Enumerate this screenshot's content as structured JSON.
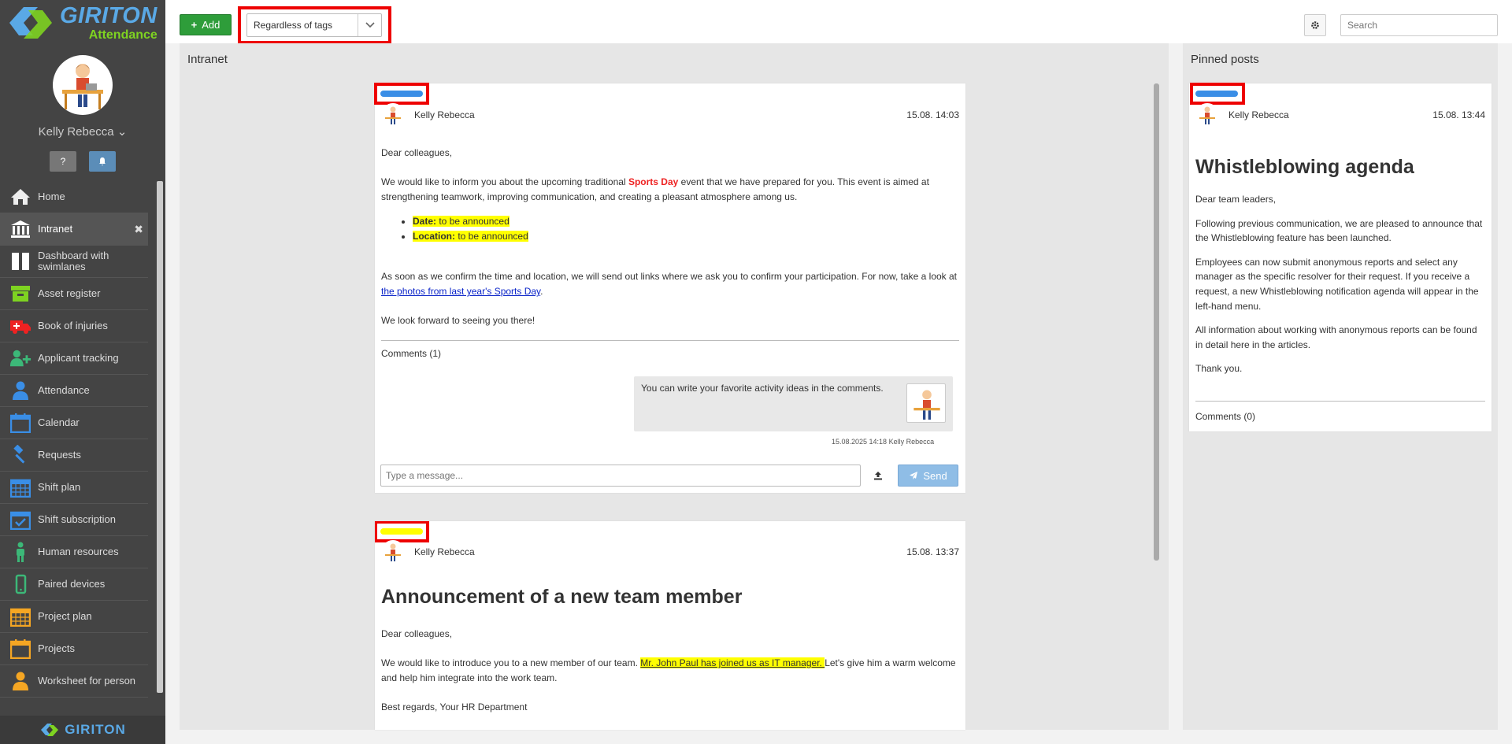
{
  "brand": {
    "name": "GIRITON",
    "product": "Attendance",
    "footer": "GIRITON"
  },
  "user": {
    "name": "Kelly Rebecca"
  },
  "sidebar": {
    "items": [
      {
        "label": "Home",
        "icon": "home-icon",
        "active": false
      },
      {
        "label": "Intranet",
        "icon": "bank-icon",
        "active": true
      },
      {
        "label": "Dashboard with swimlanes",
        "icon": "columns-icon",
        "active": false
      },
      {
        "label": "Asset register",
        "icon": "archive-icon",
        "active": false
      },
      {
        "label": "Book of injuries",
        "icon": "ambulance-icon",
        "active": false
      },
      {
        "label": "Applicant tracking",
        "icon": "user-plus-icon",
        "active": false
      },
      {
        "label": "Attendance",
        "icon": "user-icon",
        "active": false
      },
      {
        "label": "Calendar",
        "icon": "calendar-icon",
        "active": false
      },
      {
        "label": "Requests",
        "icon": "gavel-icon",
        "active": false
      },
      {
        "label": "Shift plan",
        "icon": "calendar-grid-icon",
        "active": false
      },
      {
        "label": "Shift subscription",
        "icon": "calendar-check-icon",
        "active": false
      },
      {
        "label": "Human resources",
        "icon": "person-icon",
        "active": false
      },
      {
        "label": "Paired devices",
        "icon": "mobile-icon",
        "active": false
      },
      {
        "label": "Project plan",
        "icon": "calendar-grid-icon",
        "active": false
      },
      {
        "label": "Projects",
        "icon": "calendar-icon",
        "active": false
      },
      {
        "label": "Worksheet for person",
        "icon": "user-icon",
        "active": false
      }
    ]
  },
  "toolbar": {
    "add_label": "Add",
    "tag_filter": "Regardless of tags",
    "search_placeholder": "Search"
  },
  "intranet": {
    "title": "Intranet",
    "posts": [
      {
        "tag_color": "#3a8ee6",
        "author": "Kelly Rebecca",
        "time": "15.08. 14:03",
        "greeting": "Dear colleagues,",
        "p1_a": "We would like to inform you about the upcoming traditional ",
        "p1_highlight": "Sports Day",
        "p1_b": " event that we have prepared for you. This event is aimed at strengthening teamwork, improving communication, and creating a pleasant atmosphere among us.",
        "date_label": "Date:",
        "date_value": " to be announced",
        "location_label": "Location:",
        "location_value": " to be announced",
        "p2": "As soon as we confirm the time and location, we will send out links where we ask you to confirm your participation. For now, take a look at ",
        "p2_link": "the photos from last year's Sports Day",
        "p2_end": ".",
        "closing": "We look forward to seeing you there!",
        "comments_label": "Comments (1)",
        "comment_text": "You can write your favorite activity ideas in the comments.",
        "comment_meta": "15.08.2025 14:18 Kelly Rebecca",
        "message_placeholder": "Type a message...",
        "send_label": "Send"
      },
      {
        "tag_color": "#ffff00",
        "author": "Kelly Rebecca",
        "time": "15.08. 13:37",
        "title": "Announcement of a new team member",
        "greeting": "Dear colleagues,",
        "p1_a": "We would like to introduce you to a new member of our team. ",
        "p1_highlight": "Mr. John Paul has joined us as IT manager. ",
        "p1_b": "Let's give him a warm welcome and help him integrate into the work team.",
        "closing": "Best regards, Your HR Department"
      }
    ]
  },
  "pinned": {
    "title": "Pinned posts",
    "post": {
      "tag_color": "#3a8ee6",
      "author": "Kelly Rebecca",
      "time": "15.08. 13:44",
      "title": "Whistleblowing agenda",
      "greeting": "Dear team leaders,",
      "p1": "Following previous communication, we are pleased to announce that the Whistleblowing feature has been launched.",
      "p2": "Employees can now submit anonymous reports and select any manager as the specific resolver for their request. If you receive a request, a new Whistleblowing notification agenda will appear in the left-hand menu.",
      "p3": "All information about working with anonymous reports can be found in detail here in the articles.",
      "p4": "Thank you.",
      "comments_label": "Comments (0)"
    }
  }
}
